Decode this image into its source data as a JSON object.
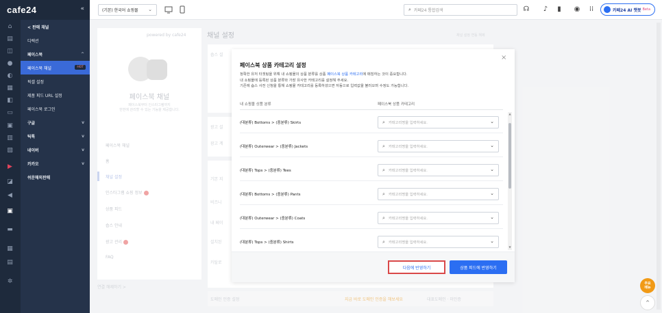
{
  "topbar": {
    "logo": "cafe24",
    "collapse": "«",
    "mall_select": "(기본) 한국어 쇼핑몰",
    "search_placeholder": "카페24 통합검색",
    "ai_label": "카페24 AI 챗봇",
    "ai_beta": "Beta"
  },
  "sidemenu": {
    "items": [
      {
        "label": "< 판매 채널",
        "bold": true
      },
      {
        "label": "디렉션"
      },
      {
        "label": "페이스북",
        "arrow": "^",
        "bold": true
      },
      {
        "label": "페이스북 채널",
        "badge": "HOT",
        "active": true
      },
      {
        "label": "픽셀 설정"
      },
      {
        "label": "제품 피드 URL 설정"
      },
      {
        "label": "페이스북 로그인"
      },
      {
        "label": "구글",
        "arrow": "v",
        "bold": true
      },
      {
        "label": "틱톡",
        "arrow": "v",
        "bold": true
      },
      {
        "label": "네이버",
        "arrow": "v",
        "bold": true
      },
      {
        "label": "카카오",
        "arrow": "v",
        "bold": true
      },
      {
        "label": "쉬운해외판매",
        "bold": true
      }
    ]
  },
  "leftcard": {
    "powered": "powered by cafe24",
    "title": "페이스북 채널",
    "desc1": "페이스북부터 인스타그램까지",
    "desc2": "한번에 관리할 수 있는 기능을 제공합니다.",
    "menu": [
      "페이스북 채널",
      "홈",
      "채널 설정",
      "인스타그램 쇼핑 정보",
      "상품 피드",
      "숍스 안내",
      "광고 관리",
      "FAQ"
    ],
    "footer": "연결 해제하기 >"
  },
  "background": {
    "title": "채널 설정",
    "guide": "채널 설정 연동 해제",
    "texts": [
      "숍스 설",
      "광고 설",
      "광고 계",
      "기본 지",
      "비즈니",
      "내 페이",
      "설치된",
      "카탈로"
    ],
    "domain_label": "도메인 인증 설정",
    "domain_status": "지금 바로 도메인 인증을 해보세요",
    "domain_select": "대표도메인 · 미인증"
  },
  "modal": {
    "title": "페이스북 상품 카테고리 설정",
    "desc_line1_a": "정확한 유저 타겟팅을 위해 내 쇼핑몰의 상품 분류를 상품 ",
    "desc_line1_link": "페이스북 상품 카테고리",
    "desc_line1_b": "에 매칭하는 것이 중요합니다.",
    "desc_line2": "내 쇼핑몰에 등록된 상품 분류와 가장 유사한 카테고리를 설정해 주세요.",
    "desc_line3": "기존에 숍스 사전 신청을 통해 쇼핑몰 카테고리를 등록하셨으면 자동으로 입력값을 불러오며 수정도 가능합니다.",
    "col_left": "내 쇼핑몰 상품 분류",
    "col_right": "페이스북 상품 카테고리",
    "rows": [
      {
        "label": "(대분류) Bottoms > (중분류) Skirts"
      },
      {
        "label": "(대분류) Outerwear > (중분류) Jackets"
      },
      {
        "label": "(대분류) Tops > (중분류) Tees"
      },
      {
        "label": "(대분류) Bottoms > (중분류) Pants"
      },
      {
        "label": "(대분류) Outerwear > (중분류) Coats"
      },
      {
        "label": "(대분류) Tops > (중분류) Shirts"
      }
    ],
    "select_placeholder": "카테고리명을 입력하세요.",
    "btn_next": "다음에 반영하기",
    "btn_apply": "상품 피드에 반영하기",
    "close": "×"
  },
  "floating": {
    "help_line1": "주요",
    "help_line2": "메뉴",
    "top": "^"
  }
}
